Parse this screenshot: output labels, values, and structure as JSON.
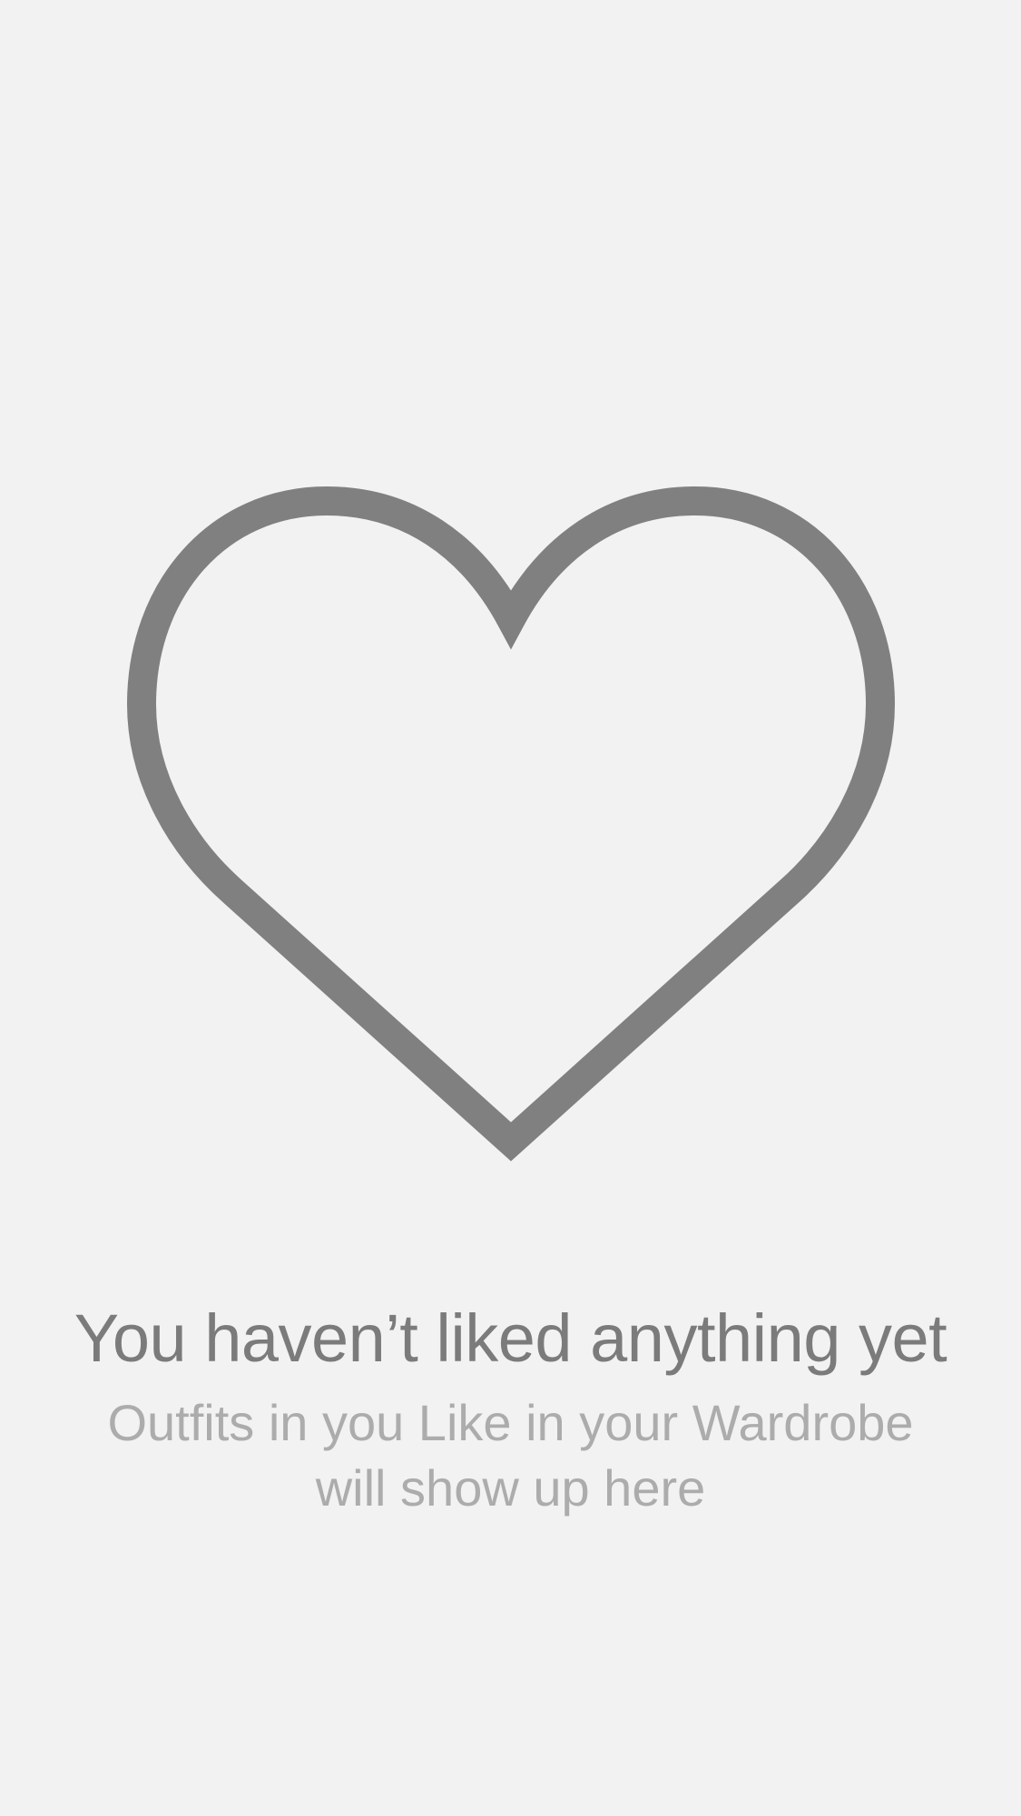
{
  "empty_state": {
    "icon": "heart-outline-icon",
    "icon_color": "#808080",
    "background_color": "#f2f2f2",
    "title": "You haven’t liked anything yet",
    "subtitle_line1": "Outfits in you Like in your Wardrobe",
    "subtitle_line2": "will show up here"
  }
}
